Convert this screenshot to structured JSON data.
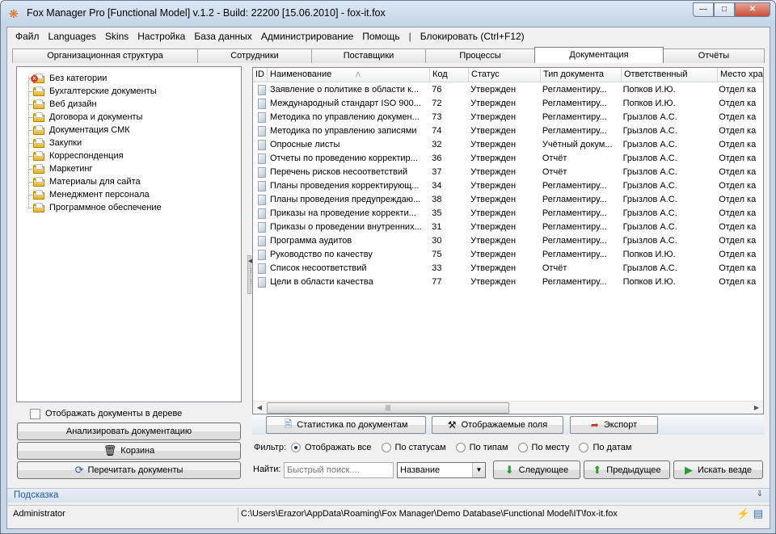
{
  "window": {
    "title": "Fox Manager Pro [Functional Model] v.1.2 - Build: 22200 [15.06.2010]  - fox-it.fox"
  },
  "menu": [
    "Файл",
    "Languages",
    "Skins",
    "Настройка",
    "База данных",
    "Администрирование",
    "Помощь",
    "|",
    "Блокировать (Ctrl+F12)"
  ],
  "tabs": [
    "Организационная структура",
    "Сотрудники",
    "Поставщики",
    "Процессы",
    "Документация",
    "Отчёты"
  ],
  "active_tab": "Документация",
  "tree": {
    "items": [
      "Без категории",
      "Бухгалтерские документы",
      "Веб дизайн",
      "Договора и документы",
      "Документация СМК",
      "Закупки",
      "Корреспонденция",
      "Маркетинг",
      "Материалы для сайта",
      "Менеджмент персонала",
      "Программное обеспечение"
    ]
  },
  "left": {
    "show_in_tree": "Отображать документы в дереве",
    "analyze": "Анализировать документацию",
    "trash": "Корзина",
    "reread": "Перечитать документы"
  },
  "grid": {
    "columns": [
      "ID",
      "Наименование",
      "Код",
      "Статус",
      "Тип документа",
      "Ответственный",
      "Место хра"
    ],
    "rows": [
      [
        "Заявление о политике в области к...",
        "76",
        "Утвержден",
        "Регламентиру...",
        "Попков И.Ю.",
        "Отдел ка"
      ],
      [
        "Международный стандарт ISO 900...",
        "72",
        "Утвержден",
        "Регламентиру...",
        "Попков И.Ю.",
        "Отдел ка"
      ],
      [
        "Методика по управлению докумен...",
        "73",
        "Утвержден",
        "Регламентиру...",
        "Грызлов А.С.",
        "Отдел ка"
      ],
      [
        "Методика по управлению записями",
        "74",
        "Утвержден",
        "Регламентиру...",
        "Грызлов А.С.",
        "Отдел ка"
      ],
      [
        "Опросные листы",
        "32",
        "Утвержден",
        "Учётный докум...",
        "Грызлов А.С.",
        "Отдел ка"
      ],
      [
        "Отчеты по проведению корректир...",
        "36",
        "Утвержден",
        "Отчёт",
        "Грызлов А.С.",
        "Отдел ка"
      ],
      [
        "Перечень рисков несоответствий",
        "37",
        "Утвержден",
        "Отчёт",
        "Грызлов А.С.",
        "Отдел ка"
      ],
      [
        "Планы проведения корректирующ...",
        "34",
        "Утвержден",
        "Регламентиру...",
        "Грызлов А.С.",
        "Отдел ка"
      ],
      [
        "Планы проведения предупреждаю...",
        "38",
        "Утвержден",
        "Регламентиру...",
        "Грызлов А.С.",
        "Отдел ка"
      ],
      [
        "Приказы на проведение корректи...",
        "35",
        "Утвержден",
        "Регламентиру...",
        "Грызлов А.С.",
        "Отдел ка"
      ],
      [
        "Приказы о проведении внутренних...",
        "31",
        "Утвержден",
        "Регламентиру...",
        "Грызлов А.С.",
        "Отдел ка"
      ],
      [
        "Программа аудитов",
        "30",
        "Утвержден",
        "Регламентиру...",
        "Грызлов А.С.",
        "Отдел ка"
      ],
      [
        "Руководство по качеству",
        "75",
        "Утвержден",
        "Регламентиру...",
        "Попков И.Ю.",
        "Отдел ка"
      ],
      [
        "Список несоответствий",
        "33",
        "Утвержден",
        "Отчёт",
        "Грызлов А.С.",
        "Отдел ка"
      ],
      [
        "Цели в области качества",
        "77",
        "Утвержден",
        "Регламентиру...",
        "Попков И.Ю.",
        "Отдел ка"
      ]
    ]
  },
  "toolbar": {
    "stats": "Статистика по документам",
    "fields": "Отображаемые поля",
    "export": "Экспорт"
  },
  "filter": {
    "label": "Фильтр:",
    "options": [
      "Отображать все",
      "По статусам",
      "По типам",
      "По месту",
      "По датам"
    ],
    "selected": "Отображать все"
  },
  "find": {
    "label": "Найти:",
    "placeholder": "Быстрый поиск....",
    "field": "Название",
    "next": "Следующее",
    "prev": "Предыдущее",
    "everywhere": "Искать везде"
  },
  "hint": "Подсказка",
  "status": {
    "user": "Administrator",
    "path": "C:\\Users\\Erazor\\AppData\\Roaming\\Fox Manager\\Demo Database\\Functional Model\\IT\\fox-it.fox"
  },
  "colors": {
    "hint_text": "#1d5aa8",
    "title_gradient": "#c2d4e9"
  }
}
